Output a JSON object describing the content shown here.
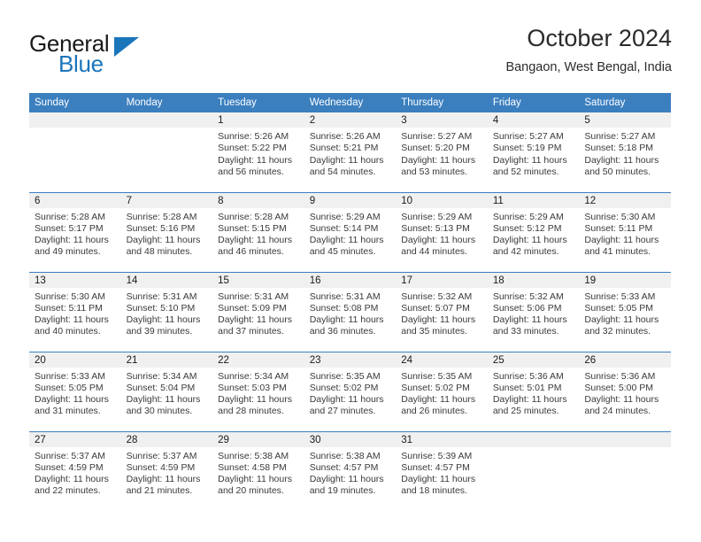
{
  "brand": {
    "name_part1": "General",
    "name_part2": "Blue",
    "accent_color": "#1b75bb"
  },
  "header": {
    "title": "October 2024",
    "location": "Bangaon, West Bengal, India"
  },
  "theme": {
    "header_row_bg": "#3b7fbf",
    "daynum_bg": "#f0f0f0",
    "text_color": "#3a3a3a"
  },
  "weekday_headers": [
    "Sunday",
    "Monday",
    "Tuesday",
    "Wednesday",
    "Thursday",
    "Friday",
    "Saturday"
  ],
  "labels": {
    "sunrise_prefix": "Sunrise: ",
    "sunset_prefix": "Sunset: ",
    "daylight_prefix": "Daylight: "
  },
  "weeks": [
    [
      {
        "day": "",
        "sunrise": "",
        "sunset": "",
        "daylight_line1": "",
        "daylight_line2": ""
      },
      {
        "day": "",
        "sunrise": "",
        "sunset": "",
        "daylight_line1": "",
        "daylight_line2": ""
      },
      {
        "day": "1",
        "sunrise": "Sunrise: 5:26 AM",
        "sunset": "Sunset: 5:22 PM",
        "daylight_line1": "Daylight: 11 hours",
        "daylight_line2": "and 56 minutes."
      },
      {
        "day": "2",
        "sunrise": "Sunrise: 5:26 AM",
        "sunset": "Sunset: 5:21 PM",
        "daylight_line1": "Daylight: 11 hours",
        "daylight_line2": "and 54 minutes."
      },
      {
        "day": "3",
        "sunrise": "Sunrise: 5:27 AM",
        "sunset": "Sunset: 5:20 PM",
        "daylight_line1": "Daylight: 11 hours",
        "daylight_line2": "and 53 minutes."
      },
      {
        "day": "4",
        "sunrise": "Sunrise: 5:27 AM",
        "sunset": "Sunset: 5:19 PM",
        "daylight_line1": "Daylight: 11 hours",
        "daylight_line2": "and 52 minutes."
      },
      {
        "day": "5",
        "sunrise": "Sunrise: 5:27 AM",
        "sunset": "Sunset: 5:18 PM",
        "daylight_line1": "Daylight: 11 hours",
        "daylight_line2": "and 50 minutes."
      }
    ],
    [
      {
        "day": "6",
        "sunrise": "Sunrise: 5:28 AM",
        "sunset": "Sunset: 5:17 PM",
        "daylight_line1": "Daylight: 11 hours",
        "daylight_line2": "and 49 minutes."
      },
      {
        "day": "7",
        "sunrise": "Sunrise: 5:28 AM",
        "sunset": "Sunset: 5:16 PM",
        "daylight_line1": "Daylight: 11 hours",
        "daylight_line2": "and 48 minutes."
      },
      {
        "day": "8",
        "sunrise": "Sunrise: 5:28 AM",
        "sunset": "Sunset: 5:15 PM",
        "daylight_line1": "Daylight: 11 hours",
        "daylight_line2": "and 46 minutes."
      },
      {
        "day": "9",
        "sunrise": "Sunrise: 5:29 AM",
        "sunset": "Sunset: 5:14 PM",
        "daylight_line1": "Daylight: 11 hours",
        "daylight_line2": "and 45 minutes."
      },
      {
        "day": "10",
        "sunrise": "Sunrise: 5:29 AM",
        "sunset": "Sunset: 5:13 PM",
        "daylight_line1": "Daylight: 11 hours",
        "daylight_line2": "and 44 minutes."
      },
      {
        "day": "11",
        "sunrise": "Sunrise: 5:29 AM",
        "sunset": "Sunset: 5:12 PM",
        "daylight_line1": "Daylight: 11 hours",
        "daylight_line2": "and 42 minutes."
      },
      {
        "day": "12",
        "sunrise": "Sunrise: 5:30 AM",
        "sunset": "Sunset: 5:11 PM",
        "daylight_line1": "Daylight: 11 hours",
        "daylight_line2": "and 41 minutes."
      }
    ],
    [
      {
        "day": "13",
        "sunrise": "Sunrise: 5:30 AM",
        "sunset": "Sunset: 5:11 PM",
        "daylight_line1": "Daylight: 11 hours",
        "daylight_line2": "and 40 minutes."
      },
      {
        "day": "14",
        "sunrise": "Sunrise: 5:31 AM",
        "sunset": "Sunset: 5:10 PM",
        "daylight_line1": "Daylight: 11 hours",
        "daylight_line2": "and 39 minutes."
      },
      {
        "day": "15",
        "sunrise": "Sunrise: 5:31 AM",
        "sunset": "Sunset: 5:09 PM",
        "daylight_line1": "Daylight: 11 hours",
        "daylight_line2": "and 37 minutes."
      },
      {
        "day": "16",
        "sunrise": "Sunrise: 5:31 AM",
        "sunset": "Sunset: 5:08 PM",
        "daylight_line1": "Daylight: 11 hours",
        "daylight_line2": "and 36 minutes."
      },
      {
        "day": "17",
        "sunrise": "Sunrise: 5:32 AM",
        "sunset": "Sunset: 5:07 PM",
        "daylight_line1": "Daylight: 11 hours",
        "daylight_line2": "and 35 minutes."
      },
      {
        "day": "18",
        "sunrise": "Sunrise: 5:32 AM",
        "sunset": "Sunset: 5:06 PM",
        "daylight_line1": "Daylight: 11 hours",
        "daylight_line2": "and 33 minutes."
      },
      {
        "day": "19",
        "sunrise": "Sunrise: 5:33 AM",
        "sunset": "Sunset: 5:05 PM",
        "daylight_line1": "Daylight: 11 hours",
        "daylight_line2": "and 32 minutes."
      }
    ],
    [
      {
        "day": "20",
        "sunrise": "Sunrise: 5:33 AM",
        "sunset": "Sunset: 5:05 PM",
        "daylight_line1": "Daylight: 11 hours",
        "daylight_line2": "and 31 minutes."
      },
      {
        "day": "21",
        "sunrise": "Sunrise: 5:34 AM",
        "sunset": "Sunset: 5:04 PM",
        "daylight_line1": "Daylight: 11 hours",
        "daylight_line2": "and 30 minutes."
      },
      {
        "day": "22",
        "sunrise": "Sunrise: 5:34 AM",
        "sunset": "Sunset: 5:03 PM",
        "daylight_line1": "Daylight: 11 hours",
        "daylight_line2": "and 28 minutes."
      },
      {
        "day": "23",
        "sunrise": "Sunrise: 5:35 AM",
        "sunset": "Sunset: 5:02 PM",
        "daylight_line1": "Daylight: 11 hours",
        "daylight_line2": "and 27 minutes."
      },
      {
        "day": "24",
        "sunrise": "Sunrise: 5:35 AM",
        "sunset": "Sunset: 5:02 PM",
        "daylight_line1": "Daylight: 11 hours",
        "daylight_line2": "and 26 minutes."
      },
      {
        "day": "25",
        "sunrise": "Sunrise: 5:36 AM",
        "sunset": "Sunset: 5:01 PM",
        "daylight_line1": "Daylight: 11 hours",
        "daylight_line2": "and 25 minutes."
      },
      {
        "day": "26",
        "sunrise": "Sunrise: 5:36 AM",
        "sunset": "Sunset: 5:00 PM",
        "daylight_line1": "Daylight: 11 hours",
        "daylight_line2": "and 24 minutes."
      }
    ],
    [
      {
        "day": "27",
        "sunrise": "Sunrise: 5:37 AM",
        "sunset": "Sunset: 4:59 PM",
        "daylight_line1": "Daylight: 11 hours",
        "daylight_line2": "and 22 minutes."
      },
      {
        "day": "28",
        "sunrise": "Sunrise: 5:37 AM",
        "sunset": "Sunset: 4:59 PM",
        "daylight_line1": "Daylight: 11 hours",
        "daylight_line2": "and 21 minutes."
      },
      {
        "day": "29",
        "sunrise": "Sunrise: 5:38 AM",
        "sunset": "Sunset: 4:58 PM",
        "daylight_line1": "Daylight: 11 hours",
        "daylight_line2": "and 20 minutes."
      },
      {
        "day": "30",
        "sunrise": "Sunrise: 5:38 AM",
        "sunset": "Sunset: 4:57 PM",
        "daylight_line1": "Daylight: 11 hours",
        "daylight_line2": "and 19 minutes."
      },
      {
        "day": "31",
        "sunrise": "Sunrise: 5:39 AM",
        "sunset": "Sunset: 4:57 PM",
        "daylight_line1": "Daylight: 11 hours",
        "daylight_line2": "and 18 minutes."
      },
      {
        "day": "",
        "sunrise": "",
        "sunset": "",
        "daylight_line1": "",
        "daylight_line2": ""
      },
      {
        "day": "",
        "sunrise": "",
        "sunset": "",
        "daylight_line1": "",
        "daylight_line2": ""
      }
    ]
  ]
}
